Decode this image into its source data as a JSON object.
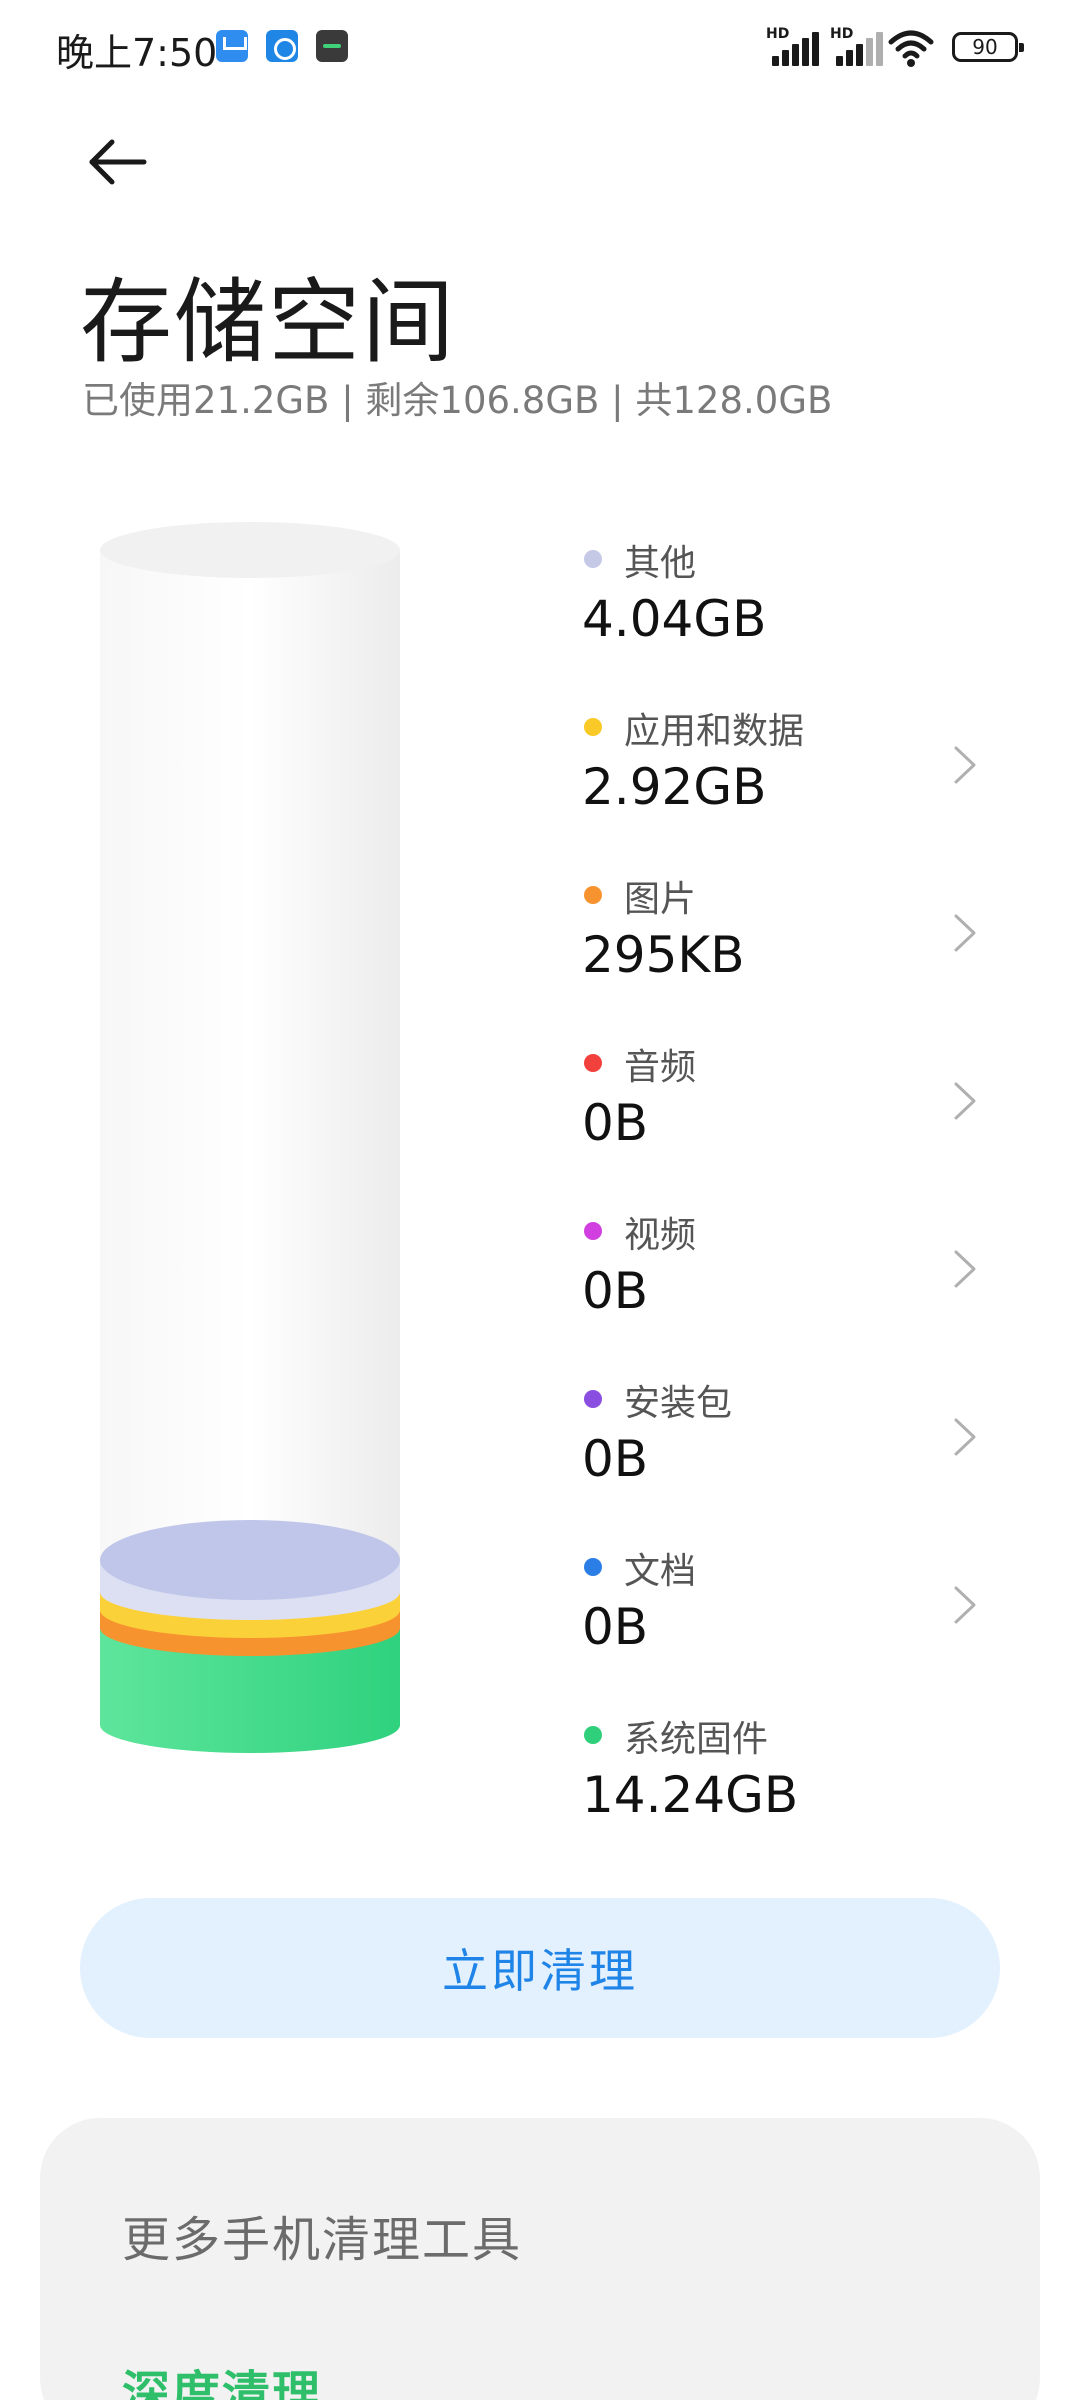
{
  "status_bar": {
    "time": "晚上7:50",
    "notification_icons": [
      "mail-icon",
      "app-icon",
      "game-icon"
    ],
    "signal_labels": [
      "HD",
      "HD"
    ],
    "battery_level": "90"
  },
  "header": {
    "title": "存储空间",
    "summary": "已使用21.2GB | 剩余106.8GB | 共128.0GB"
  },
  "storage_breakdown": [
    {
      "label": "其他",
      "value": "4.04GB",
      "color": "#c5c9e6",
      "has_arrow": false
    },
    {
      "label": "应用和数据",
      "value": "2.92GB",
      "color": "#f9c928",
      "has_arrow": true
    },
    {
      "label": "图片",
      "value": "295KB",
      "color": "#f7932e",
      "has_arrow": true
    },
    {
      "label": "音频",
      "value": "0B",
      "color": "#f2413d",
      "has_arrow": true
    },
    {
      "label": "视频",
      "value": "0B",
      "color": "#d23fe0",
      "has_arrow": true
    },
    {
      "label": "安装包",
      "value": "0B",
      "color": "#8a4ee0",
      "has_arrow": true
    },
    {
      "label": "文档",
      "value": "0B",
      "color": "#2b7ee6",
      "has_arrow": true
    },
    {
      "label": "系统固件",
      "value": "14.24GB",
      "color": "#2fcf7c",
      "has_arrow": false
    }
  ],
  "actions": {
    "clean_now": "立即清理"
  },
  "tools_card": {
    "title": "更多手机清理工具",
    "deep_clean": "深度清理"
  },
  "colors": {
    "accent_blue": "#1f84e8",
    "button_bg": "#e3f0fd",
    "card_bg": "#f2f2f2",
    "green_link": "#2fbf6a"
  }
}
